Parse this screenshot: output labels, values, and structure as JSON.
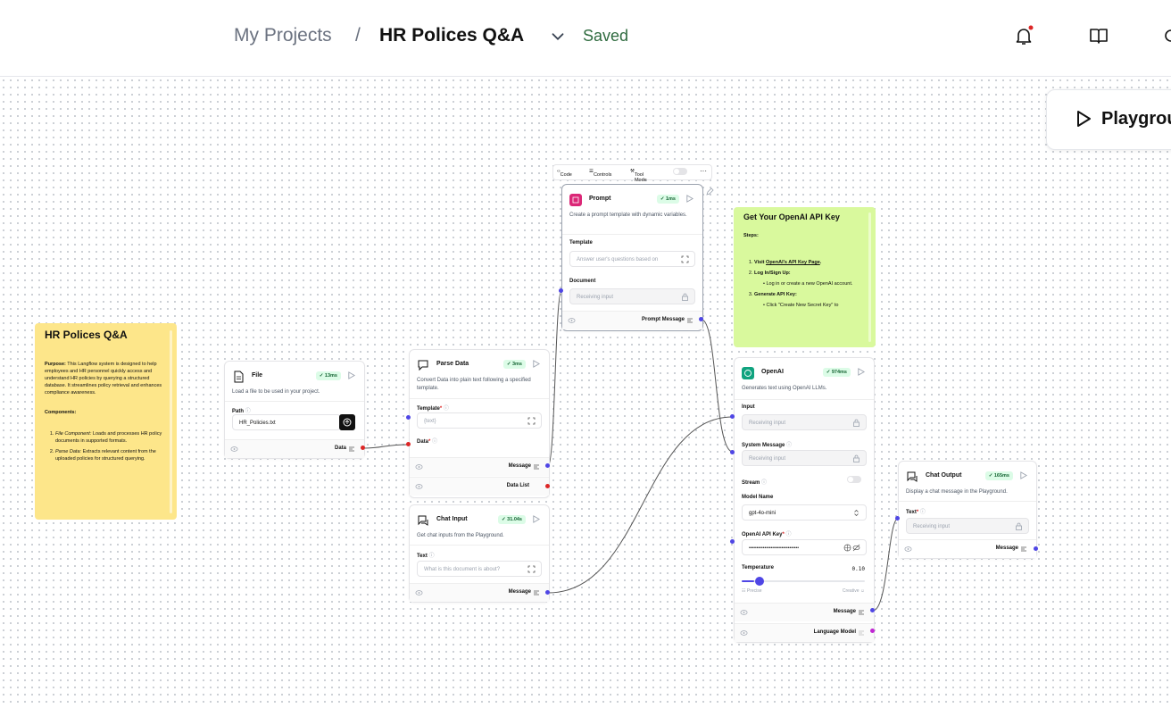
{
  "header": {
    "project_label": "My Projects",
    "separator": "/",
    "flow_title": "HR Polices Q&A",
    "status": "Saved",
    "icons": [
      "bell-icon",
      "book-icon",
      "settings-icon"
    ]
  },
  "playground": {
    "label": "Playground"
  },
  "toolbar": {
    "code": "Code",
    "controls": "Controls",
    "tool_mode": "Tool Mode"
  },
  "notes": {
    "hr": {
      "title": "HR Polices Q&A",
      "purpose_label": "Purpose:",
      "purpose_text": "This Langflow system is designed to help employees and HR personnel quickly access and understand HR policies by querying a structured database. It streamlines policy retrieval and enhances compliance awareness.",
      "components_label": "Components:",
      "items": [
        {
          "name": "File Component:",
          "text": "Loads and processes HR policy documents in supported formats."
        },
        {
          "name": "Parse Data:",
          "text": "Extracts relevant content from the uploaded policies for structured querying."
        }
      ]
    },
    "openai": {
      "title": "Get Your OpenAI API Key",
      "steps_label": "Steps:",
      "step1_prefix": "Visit",
      "step1_link": "OpenAI's API Key Page",
      "step1_suffix": ".",
      "step2": "Log In/Sign Up:",
      "step2_sub": "Log in or create a new OpenAI account.",
      "step3": "Generate API Key:",
      "step3_sub": "Click \"Create New Secret Key\" to"
    }
  },
  "nodes": {
    "file": {
      "title": "File",
      "badge": "13ms",
      "description": "Load a file to be used in your project.",
      "path_label": "Path",
      "path_value": "HR_Policies.txt",
      "output": "Data"
    },
    "parse": {
      "title": "Parse Data",
      "badge": "3ms",
      "description": "Convert Data into plain text following a specified template.",
      "template_label": "Template",
      "required": "*",
      "template_value": "{text}",
      "data_label": "Data",
      "output1": "Message",
      "output2": "Data List"
    },
    "prompt": {
      "title": "Prompt",
      "badge": "1ms",
      "description": "Create a prompt template with dynamic variables.",
      "template_label": "Template",
      "template_value": "Answer user's questions based on",
      "document_label": "Document",
      "document_value": "Receiving input",
      "output": "Prompt Message"
    },
    "chat_input": {
      "title": "Chat Input",
      "badge": "31.04s",
      "description": "Get chat inputs from the Playground.",
      "text_label": "Text",
      "text_placeholder": "What is this document is about?",
      "output": "Message"
    },
    "openai": {
      "title": "OpenAI",
      "badge": "974ms",
      "description": "Generates text using OpenAI LLMs.",
      "input_label": "Input",
      "input_value": "Receiving input",
      "system_label": "System Message",
      "system_value": "Receiving input",
      "stream_label": "Stream",
      "model_label": "Model Name",
      "model_value": "gpt-4o-mini",
      "key_label": "OpenAI API Key",
      "key_value": "••••••••••••••••••••••••••••••••",
      "temp_label": "Temperature",
      "temp_value": "0.10",
      "temperature": 0.1,
      "precise": "Precise",
      "creative": "Creative",
      "output1": "Message",
      "output2": "Language Model"
    },
    "chat_output": {
      "title": "Chat Output",
      "badge": "165ms",
      "description": "Display a chat message in the Playground.",
      "text_label": "Text",
      "text_value": "Receiving input",
      "output": "Message"
    }
  },
  "colors": {
    "accent": "#4f46e5",
    "red_handle": "#dc2626",
    "purple_handle": "#c026d3",
    "yellow_note": "#fde68a",
    "green_note": "#d9f99d",
    "badge_bg": "#dcfce7"
  }
}
